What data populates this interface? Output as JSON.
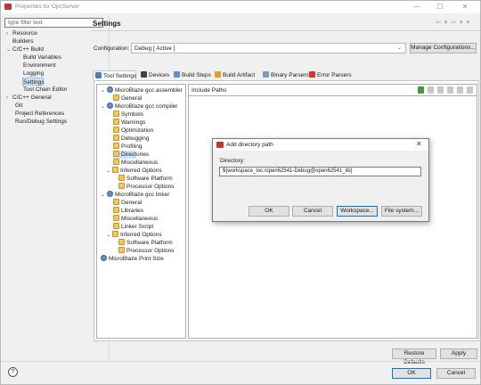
{
  "window": {
    "title": "Properties for OpcServer",
    "minimize": "—",
    "maximize": "☐",
    "close": "✕"
  },
  "sidebar": {
    "filter_placeholder": "type filter text",
    "items": [
      {
        "label": "Resource",
        "twisty": "›"
      },
      {
        "label": "Builders",
        "twisty": ""
      },
      {
        "label": "C/C++ Build",
        "twisty": "⌄"
      },
      {
        "label": "Build Variables",
        "twisty": ""
      },
      {
        "label": "Environment",
        "twisty": ""
      },
      {
        "label": "Logging",
        "twisty": ""
      },
      {
        "label": "Settings",
        "twisty": ""
      },
      {
        "label": "Tool Chain Editor",
        "twisty": ""
      },
      {
        "label": "C/C++ General",
        "twisty": "›"
      },
      {
        "label": "Git",
        "twisty": ""
      },
      {
        "label": "Project References",
        "twisty": ""
      },
      {
        "label": "Run/Debug Settings",
        "twisty": ""
      }
    ]
  },
  "header": {
    "title": "Settings",
    "nav_arrows": "⇦ ▾ ⇨ ▾ ▾"
  },
  "configuration": {
    "label": "Configuration:",
    "value": "Debug  [ Active ]",
    "chevron": "⌄",
    "manage_button": "Manage Configurations..."
  },
  "tabs": [
    {
      "label": "Tool Settings",
      "color": "#4a7fbf"
    },
    {
      "label": "Devices",
      "color": "#404040"
    },
    {
      "label": "Build Steps",
      "color": "#5d8fc9"
    },
    {
      "label": "Build Artifact",
      "color": "#e0a020"
    },
    {
      "label": "Binary Parsers",
      "color": "#7a9ac0"
    },
    {
      "label": "Error Parsers",
      "color": "#d9342b"
    }
  ],
  "tool_tree": [
    {
      "label": "MicroBlaze gcc assembler",
      "twisty": "⌄",
      "icon": "gear"
    },
    {
      "label": "General",
      "twisty": "",
      "icon": "folder"
    },
    {
      "label": "MicroBlaze gcc compiler",
      "twisty": "⌄",
      "icon": "gear"
    },
    {
      "label": "Symbols",
      "twisty": "",
      "icon": "folder"
    },
    {
      "label": "Warnings",
      "twisty": "",
      "icon": "folder"
    },
    {
      "label": "Optimization",
      "twisty": "",
      "icon": "folder"
    },
    {
      "label": "Debugging",
      "twisty": "",
      "icon": "folder"
    },
    {
      "label": "Profiling",
      "twisty": "",
      "icon": "folder"
    },
    {
      "label": "Directories",
      "twisty": "",
      "icon": "folder"
    },
    {
      "label": "Miscellaneous",
      "twisty": "",
      "icon": "folder"
    },
    {
      "label": "Inferred Options",
      "twisty": "⌄",
      "icon": "folder"
    },
    {
      "label": "Software Platform",
      "twisty": "",
      "icon": "folder"
    },
    {
      "label": "Processor Options",
      "twisty": "",
      "icon": "folder"
    },
    {
      "label": "MicroBlaze gcc linker",
      "twisty": "⌄",
      "icon": "gear"
    },
    {
      "label": "General",
      "twisty": "",
      "icon": "folder"
    },
    {
      "label": "Libraries",
      "twisty": "",
      "icon": "folder"
    },
    {
      "label": "Miscellaneous",
      "twisty": "",
      "icon": "folder"
    },
    {
      "label": "Linker Script",
      "twisty": "",
      "icon": "folder"
    },
    {
      "label": "Inferred Options",
      "twisty": "⌄",
      "icon": "folder"
    },
    {
      "label": "Software Platform",
      "twisty": "",
      "icon": "folder"
    },
    {
      "label": "Processor Options",
      "twisty": "",
      "icon": "folder"
    },
    {
      "label": "MicroBlaze Print Size",
      "twisty": "",
      "icon": "gear"
    }
  ],
  "include_paths": {
    "label": "Include Paths"
  },
  "dialog": {
    "title": "Add directory path",
    "close": "✕",
    "directory_label": "Directory:",
    "directory_value": "${workspace_loc:/open62541-Debug@open62541_lib}",
    "ok": "OK",
    "cancel": "Cancel",
    "workspace": "Workspace...",
    "file_system": "File system..."
  },
  "footer": {
    "restore_defaults": "Restore Defaults",
    "apply": "Apply",
    "ok": "OK",
    "cancel": "Cancel",
    "help": "?"
  }
}
